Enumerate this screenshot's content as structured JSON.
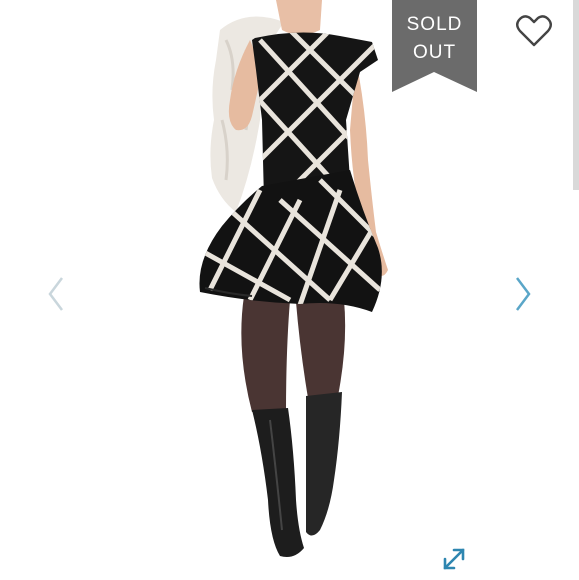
{
  "listing": {
    "status_badge": {
      "line1": "SOLD",
      "line2": "OUT"
    }
  },
  "icons": {
    "like": "heart-outline-icon",
    "previous": "chevron-left-icon",
    "next": "chevron-right-icon",
    "fullscreen": "expand-diagonal-icon"
  },
  "colors": {
    "badge_background": "#6b6b6b",
    "nav_arrow_next": "#5aa6c8",
    "nav_arrow_prev": "#c9d6dc",
    "expand_icon": "#2e86b0",
    "heart_outline": "#444444"
  }
}
